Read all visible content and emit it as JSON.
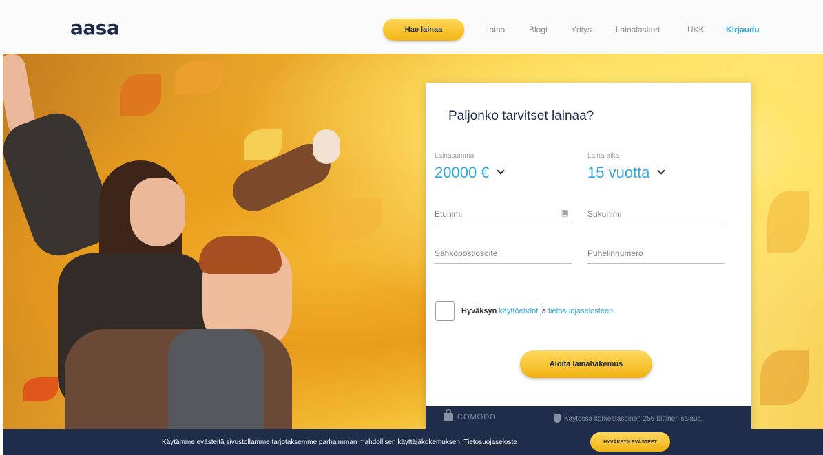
{
  "nav": {
    "logo": "aasa",
    "cta_label": "Hae lainaa",
    "links": [
      "Laina",
      "Blogi",
      "Yritys",
      "Lainalaskuri",
      "UKK"
    ],
    "login_label": "Kirjaudu"
  },
  "form": {
    "title": "Paljonko tarvitset lainaa?",
    "amount_label": "Lainasumma",
    "amount_value": "20000 €",
    "term_label": "Laina-aika",
    "term_value": "15 vuotta",
    "first_name_placeholder": "Etunimi",
    "last_name_placeholder": "Sukunimi",
    "email_placeholder": "Sähköpostiosoite",
    "phone_placeholder": "Puhelinnumero",
    "accept_prefix": "Hyväksyn",
    "terms_link": "käyttöehdot",
    "accept_and": "ja",
    "privacy_link": "tietosuojaselosteen",
    "submit_label": "Aloita lainahakemus",
    "comodo_label": "COMODO",
    "security_text": "Käytössä korkeatasoinen 256-bittinen salaus."
  },
  "cookie": {
    "text": "Käytämme evästeitä sivustollamme tarjotaksemme parhaimman mahdollisen käyttäjäkokemuksen.",
    "link": "Tietosuojaseloste",
    "accept_label": "HYVÄKSYN EVÄSTEET"
  },
  "colors": {
    "navy": "#1f2d4a",
    "accent_blue": "#2fa9e0",
    "yellow": "#f5c02a"
  }
}
